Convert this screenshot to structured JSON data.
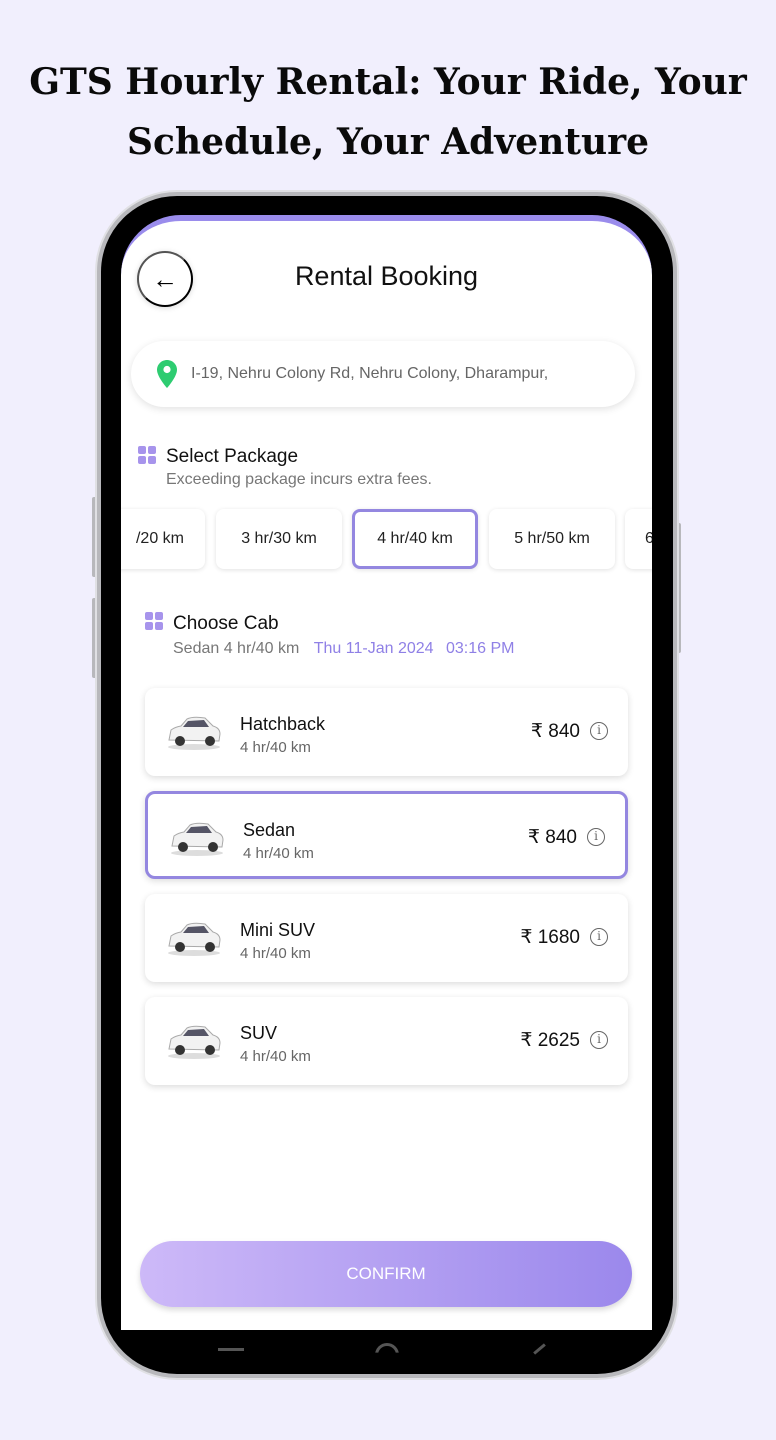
{
  "headline": {
    "line1": "GTS Hourly Rental: Your Ride, Your",
    "line2": "Schedule, Your Adventure"
  },
  "header": {
    "title": "Rental Booking",
    "back_icon": "arrow-left-icon"
  },
  "location": {
    "icon": "map-pin-icon",
    "value": "I-19, Nehru Colony Rd, Nehru Colony, Dharampur,",
    "pin_color": "#2ecc71"
  },
  "package": {
    "title": "Select Package",
    "subtitle": "Exceeding package incurs extra fees.",
    "options": [
      "/20 km",
      "3 hr/30 km",
      "4 hr/40 km",
      "5 hr/50 km",
      "6"
    ],
    "selected": "4 hr/40 km"
  },
  "cab": {
    "title": "Choose Cab",
    "summary": "Sedan 4 hr/40 km",
    "date": "Thu 11-Jan 2024",
    "time": "03:16 PM",
    "items": [
      {
        "name": "Hatchback",
        "package": "4 hr/40 km",
        "price": "₹ 840"
      },
      {
        "name": "Sedan",
        "package": "4 hr/40 km",
        "price": "₹ 840",
        "selected": true
      },
      {
        "name": "Mini SUV",
        "package": "4 hr/40 km",
        "price": "₹ 1680"
      },
      {
        "name": "SUV",
        "package": "4 hr/40 km",
        "price": "₹ 2625"
      }
    ]
  },
  "confirm_label": "CONFIRM",
  "colors": {
    "accent": "#9487e0",
    "accent_text": "#8f80e6",
    "background": "#f1effd"
  }
}
